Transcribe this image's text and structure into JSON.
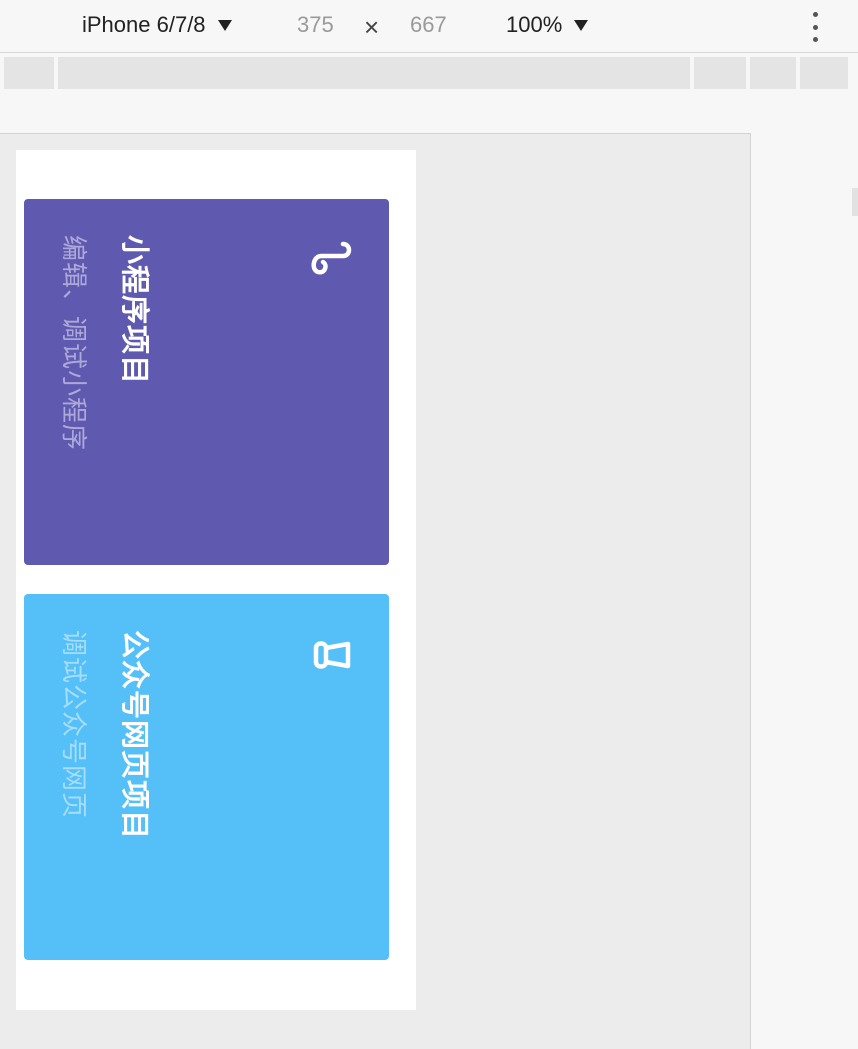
{
  "toolbar": {
    "device": "iPhone 6/7/8",
    "width": "375",
    "times": "×",
    "height": "667",
    "zoom": "100%"
  },
  "cards": [
    {
      "title": "小程序项目",
      "description": "编辑、调试小程序",
      "icon": "mini-program-icon",
      "color": "#5f59af"
    },
    {
      "title": "公众号网页项目",
      "description": "调试公众号网页",
      "icon": "official-account-icon",
      "color": "#55bff7"
    }
  ]
}
